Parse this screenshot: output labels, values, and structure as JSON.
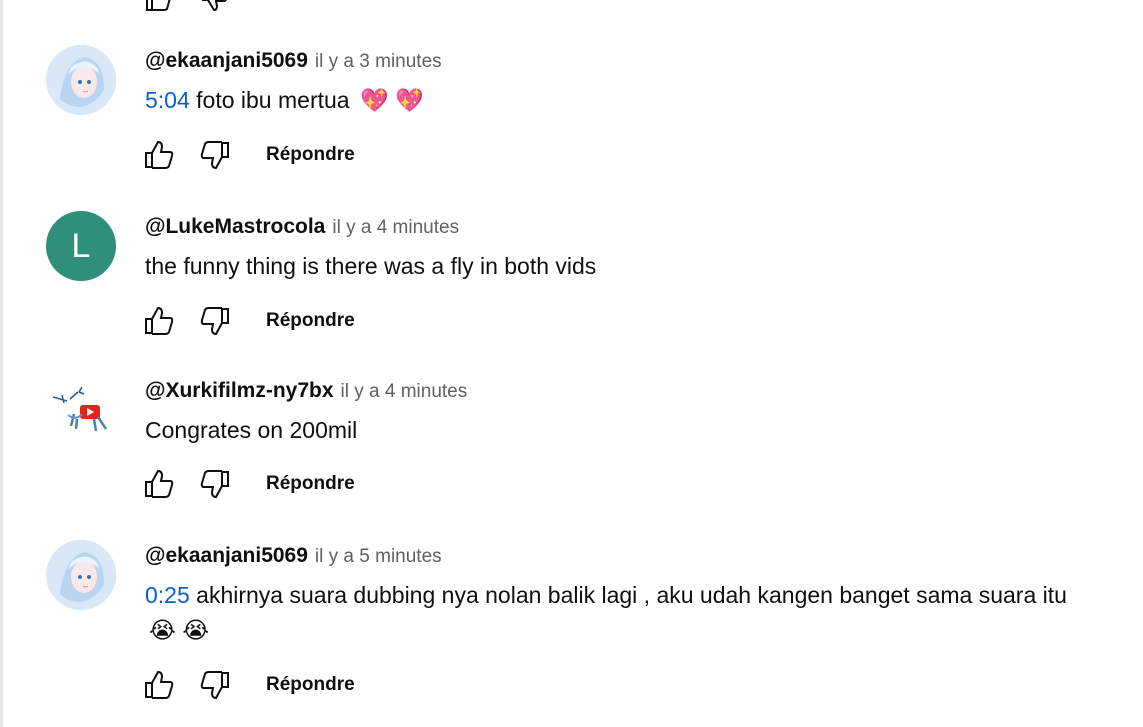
{
  "comments": [
    {
      "author": "@ekaanjani5069",
      "time": "il y a 3 minutes",
      "timestamp": "5:04",
      "text": "foto ibu mertua",
      "emoji": "💖 💖",
      "reply_label": "Répondre",
      "avatar": "anime-girl-avatar"
    },
    {
      "author": "@LukeMastrocola",
      "time": "il y a 4 minutes",
      "text": "the funny thing is there was a fly in both vids",
      "reply_label": "Répondre",
      "avatar_letter": "L",
      "avatar_color": "#2f8f7b"
    },
    {
      "author": "@Xurkifilmz-ny7bx",
      "time": "il y a 4 minutes",
      "text": "Congrates on 200mil",
      "reply_label": "Répondre",
      "avatar": "robot-avatar"
    },
    {
      "author": "@ekaanjani5069",
      "time": "il y a 5 minutes",
      "timestamp": "0:25",
      "text": "akhirnya suara dubbing nya nolan balik lagi , aku udah kangen banget sama suara itu",
      "emoji": "😭 😭",
      "reply_label": "Répondre",
      "avatar": "anime-girl-avatar"
    }
  ],
  "colors": {
    "timestamp_link": "#065fd4",
    "secondary_text": "#606060",
    "primary_text": "#0f0f0f"
  }
}
